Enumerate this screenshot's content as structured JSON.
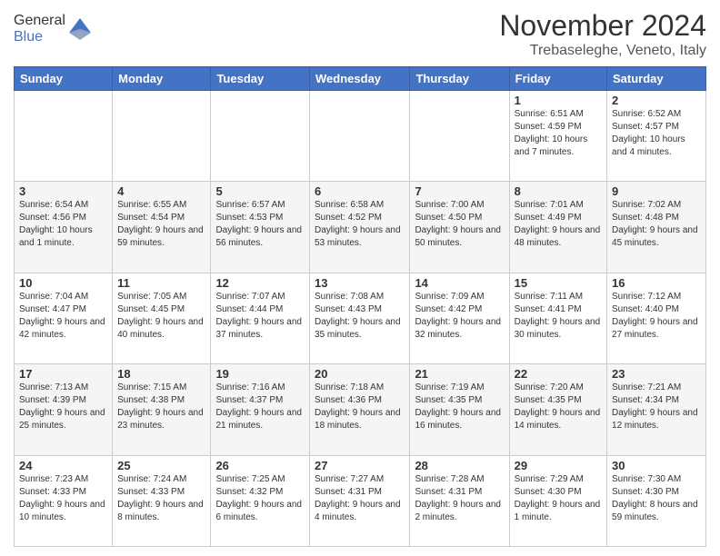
{
  "logo": {
    "general": "General",
    "blue": "Blue"
  },
  "header": {
    "month": "November 2024",
    "location": "Trebaseleghe, Veneto, Italy"
  },
  "weekdays": [
    "Sunday",
    "Monday",
    "Tuesday",
    "Wednesday",
    "Thursday",
    "Friday",
    "Saturday"
  ],
  "weeks": [
    [
      {
        "day": "",
        "info": ""
      },
      {
        "day": "",
        "info": ""
      },
      {
        "day": "",
        "info": ""
      },
      {
        "day": "",
        "info": ""
      },
      {
        "day": "",
        "info": ""
      },
      {
        "day": "1",
        "info": "Sunrise: 6:51 AM\nSunset: 4:59 PM\nDaylight: 10 hours and 7 minutes."
      },
      {
        "day": "2",
        "info": "Sunrise: 6:52 AM\nSunset: 4:57 PM\nDaylight: 10 hours and 4 minutes."
      }
    ],
    [
      {
        "day": "3",
        "info": "Sunrise: 6:54 AM\nSunset: 4:56 PM\nDaylight: 10 hours and 1 minute."
      },
      {
        "day": "4",
        "info": "Sunrise: 6:55 AM\nSunset: 4:54 PM\nDaylight: 9 hours and 59 minutes."
      },
      {
        "day": "5",
        "info": "Sunrise: 6:57 AM\nSunset: 4:53 PM\nDaylight: 9 hours and 56 minutes."
      },
      {
        "day": "6",
        "info": "Sunrise: 6:58 AM\nSunset: 4:52 PM\nDaylight: 9 hours and 53 minutes."
      },
      {
        "day": "7",
        "info": "Sunrise: 7:00 AM\nSunset: 4:50 PM\nDaylight: 9 hours and 50 minutes."
      },
      {
        "day": "8",
        "info": "Sunrise: 7:01 AM\nSunset: 4:49 PM\nDaylight: 9 hours and 48 minutes."
      },
      {
        "day": "9",
        "info": "Sunrise: 7:02 AM\nSunset: 4:48 PM\nDaylight: 9 hours and 45 minutes."
      }
    ],
    [
      {
        "day": "10",
        "info": "Sunrise: 7:04 AM\nSunset: 4:47 PM\nDaylight: 9 hours and 42 minutes."
      },
      {
        "day": "11",
        "info": "Sunrise: 7:05 AM\nSunset: 4:45 PM\nDaylight: 9 hours and 40 minutes."
      },
      {
        "day": "12",
        "info": "Sunrise: 7:07 AM\nSunset: 4:44 PM\nDaylight: 9 hours and 37 minutes."
      },
      {
        "day": "13",
        "info": "Sunrise: 7:08 AM\nSunset: 4:43 PM\nDaylight: 9 hours and 35 minutes."
      },
      {
        "day": "14",
        "info": "Sunrise: 7:09 AM\nSunset: 4:42 PM\nDaylight: 9 hours and 32 minutes."
      },
      {
        "day": "15",
        "info": "Sunrise: 7:11 AM\nSunset: 4:41 PM\nDaylight: 9 hours and 30 minutes."
      },
      {
        "day": "16",
        "info": "Sunrise: 7:12 AM\nSunset: 4:40 PM\nDaylight: 9 hours and 27 minutes."
      }
    ],
    [
      {
        "day": "17",
        "info": "Sunrise: 7:13 AM\nSunset: 4:39 PM\nDaylight: 9 hours and 25 minutes."
      },
      {
        "day": "18",
        "info": "Sunrise: 7:15 AM\nSunset: 4:38 PM\nDaylight: 9 hours and 23 minutes."
      },
      {
        "day": "19",
        "info": "Sunrise: 7:16 AM\nSunset: 4:37 PM\nDaylight: 9 hours and 21 minutes."
      },
      {
        "day": "20",
        "info": "Sunrise: 7:18 AM\nSunset: 4:36 PM\nDaylight: 9 hours and 18 minutes."
      },
      {
        "day": "21",
        "info": "Sunrise: 7:19 AM\nSunset: 4:35 PM\nDaylight: 9 hours and 16 minutes."
      },
      {
        "day": "22",
        "info": "Sunrise: 7:20 AM\nSunset: 4:35 PM\nDaylight: 9 hours and 14 minutes."
      },
      {
        "day": "23",
        "info": "Sunrise: 7:21 AM\nSunset: 4:34 PM\nDaylight: 9 hours and 12 minutes."
      }
    ],
    [
      {
        "day": "24",
        "info": "Sunrise: 7:23 AM\nSunset: 4:33 PM\nDaylight: 9 hours and 10 minutes."
      },
      {
        "day": "25",
        "info": "Sunrise: 7:24 AM\nSunset: 4:33 PM\nDaylight: 9 hours and 8 minutes."
      },
      {
        "day": "26",
        "info": "Sunrise: 7:25 AM\nSunset: 4:32 PM\nDaylight: 9 hours and 6 minutes."
      },
      {
        "day": "27",
        "info": "Sunrise: 7:27 AM\nSunset: 4:31 PM\nDaylight: 9 hours and 4 minutes."
      },
      {
        "day": "28",
        "info": "Sunrise: 7:28 AM\nSunset: 4:31 PM\nDaylight: 9 hours and 2 minutes."
      },
      {
        "day": "29",
        "info": "Sunrise: 7:29 AM\nSunset: 4:30 PM\nDaylight: 9 hours and 1 minute."
      },
      {
        "day": "30",
        "info": "Sunrise: 7:30 AM\nSunset: 4:30 PM\nDaylight: 8 hours and 59 minutes."
      }
    ]
  ]
}
